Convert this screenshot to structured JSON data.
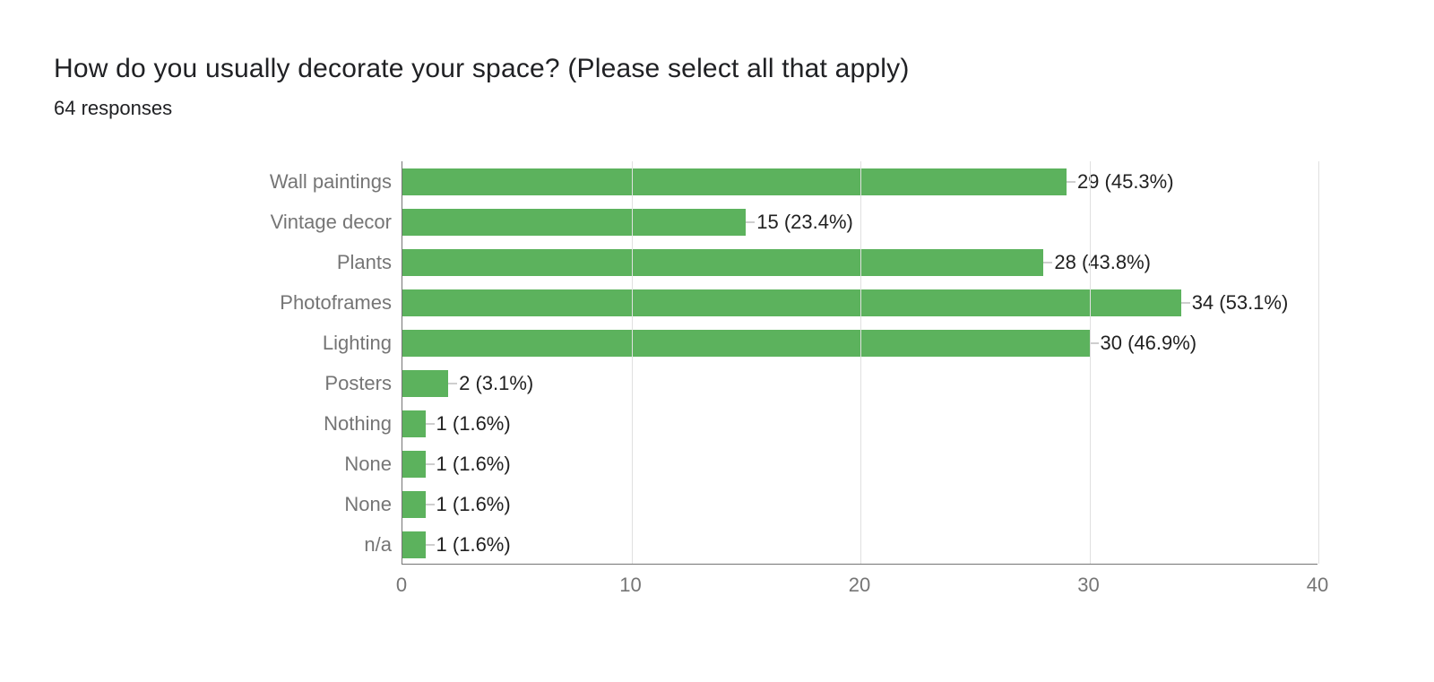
{
  "title": "How do you usually decorate your space? (Please select all that apply)",
  "subtitle": "64 responses",
  "chart_data": {
    "type": "bar",
    "orientation": "horizontal",
    "categories": [
      "Wall paintings",
      "Vintage decor",
      "Plants",
      "Photoframes",
      "Lighting",
      "Posters",
      "Nothing",
      "None",
      "None",
      "n/a"
    ],
    "values": [
      29,
      15,
      28,
      34,
      30,
      2,
      1,
      1,
      1,
      1
    ],
    "percents": [
      "45.3%",
      "23.4%",
      "43.8%",
      "53.1%",
      "46.9%",
      "3.1%",
      "1.6%",
      "1.6%",
      "1.6%",
      "1.6%"
    ],
    "xlim": [
      0,
      40
    ],
    "x_ticks": [
      0,
      10,
      20,
      30,
      40
    ],
    "bar_color": "#5cb25d",
    "title": "",
    "xlabel": "",
    "ylabel": ""
  }
}
